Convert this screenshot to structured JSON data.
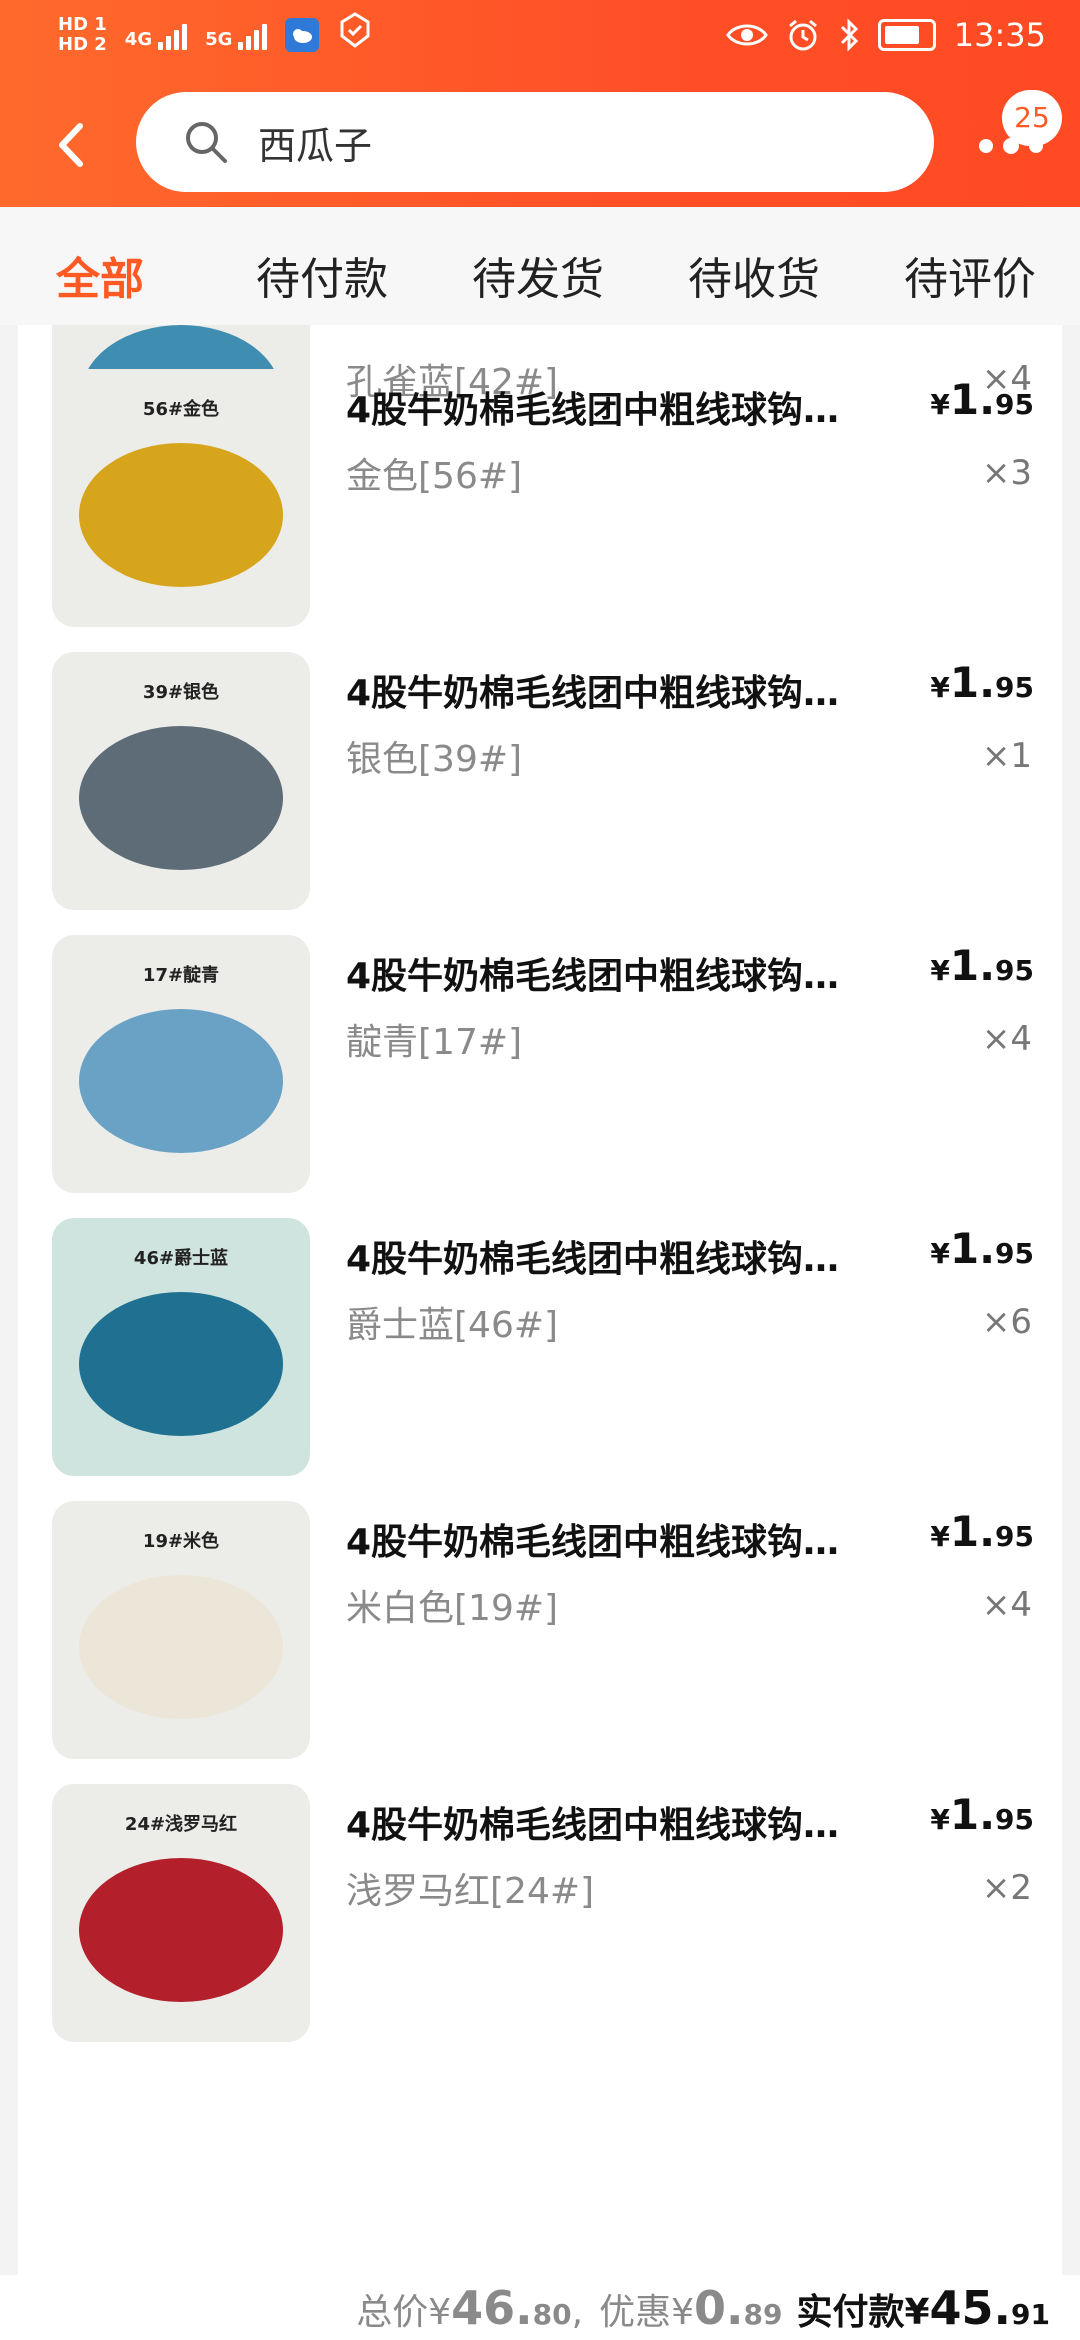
{
  "status": {
    "time": "13:35",
    "hd1": "HD 1",
    "hd2": "HD 2",
    "net1": "4G",
    "net2": "5G"
  },
  "header": {
    "search_text": "西瓜子",
    "badge_count": "25",
    "accent": "#ff5a24"
  },
  "tabs": [
    {
      "label": "全部"
    },
    {
      "label": "待付款"
    },
    {
      "label": "待发货"
    },
    {
      "label": "待收货"
    },
    {
      "label": "待评价"
    }
  ],
  "items": [
    {
      "image_label": "",
      "title": "",
      "spec": "孔雀蓝[42#]",
      "price_symbol": "",
      "price_int": "",
      "price_dec": "",
      "qty": "×4",
      "yarn_color": "#3f8db0"
    },
    {
      "image_label": "56#金色",
      "title": "4股牛奶棉毛线团中粗线球钩…",
      "spec": "金色[56#]",
      "price_symbol": "¥",
      "price_int": "1.",
      "price_dec": "95",
      "qty": "×3",
      "yarn_color": "#d7a51b"
    },
    {
      "image_label": "39#银色",
      "title": "4股牛奶棉毛线团中粗线球钩…",
      "spec": "银色[39#]",
      "price_symbol": "¥",
      "price_int": "1.",
      "price_dec": "95",
      "qty": "×1",
      "yarn_color": "#5e6c77"
    },
    {
      "image_label": "17#靛青",
      "title": "4股牛奶棉毛线团中粗线球钩…",
      "spec": "靛青[17#]",
      "price_symbol": "¥",
      "price_int": "1.",
      "price_dec": "95",
      "qty": "×4",
      "yarn_color": "#6aa2c6"
    },
    {
      "image_label": "46#爵士蓝",
      "title": "4股牛奶棉毛线团中粗线球钩…",
      "spec": "爵士蓝[46#]",
      "price_symbol": "¥",
      "price_int": "1.",
      "price_dec": "95",
      "qty": "×6",
      "yarn_color": "#1f7091"
    },
    {
      "image_label": "19#米色",
      "title": "4股牛奶棉毛线团中粗线球钩…",
      "spec": "米白色[19#]",
      "price_symbol": "¥",
      "price_int": "1.",
      "price_dec": "95",
      "qty": "×4",
      "yarn_color": "#ece6d9"
    },
    {
      "image_label": "24#浅罗马红",
      "title": "4股牛奶棉毛线团中粗线球钩…",
      "spec": "浅罗马红[24#]",
      "price_symbol": "¥",
      "price_int": "1.",
      "price_dec": "95",
      "qty": "×2",
      "yarn_color": "#b3202b"
    }
  ],
  "summary": {
    "total_label": "总价",
    "total_symbol": "¥",
    "total_int": "46.",
    "total_dec": "80",
    "sep": ",",
    "discount_label": "优惠",
    "discount_symbol": "¥",
    "discount_int": "0.",
    "discount_dec": "89",
    "pay_label": "实付款",
    "pay_symbol": "¥",
    "pay_int": "45.",
    "pay_dec": "91"
  }
}
